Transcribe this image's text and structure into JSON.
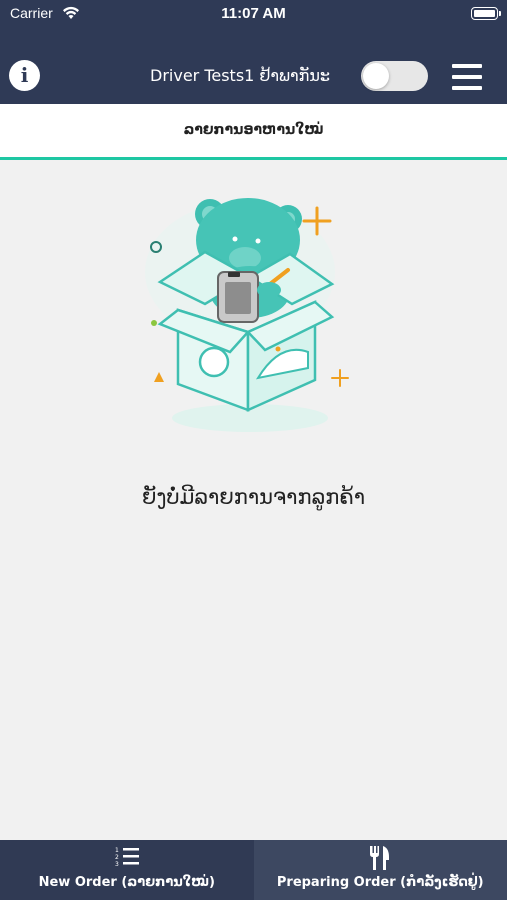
{
  "status_bar": {
    "carrier": "Carrier",
    "time": "11:07 AM"
  },
  "nav": {
    "info_glyph": "i",
    "driver_name": "Driver Tests1 ຢ້າພາກັນະ",
    "toggle_on": false
  },
  "tab": {
    "title": "ລາຍການອາຫານໃໝ່"
  },
  "empty_state": {
    "message": "ຍັງບໍ່ມີລາຍການຈາກລູກຄ້າ",
    "illustration": "teal-bear-in-box-with-phone"
  },
  "bottom_tabs": [
    {
      "label": "New Order (ລາຍການໃໝ່)",
      "icon": "numbered-list-icon",
      "active": true
    },
    {
      "label": "Preparing Order (ກຳລັງເຮັດຢູ່)",
      "icon": "fork-knife-icon",
      "active": false
    }
  ],
  "colors": {
    "header_bg": "#2f3a56",
    "accent_teal": "#1ec7a3",
    "background": "#f1f1f1",
    "orange_accent": "#f0a020"
  }
}
